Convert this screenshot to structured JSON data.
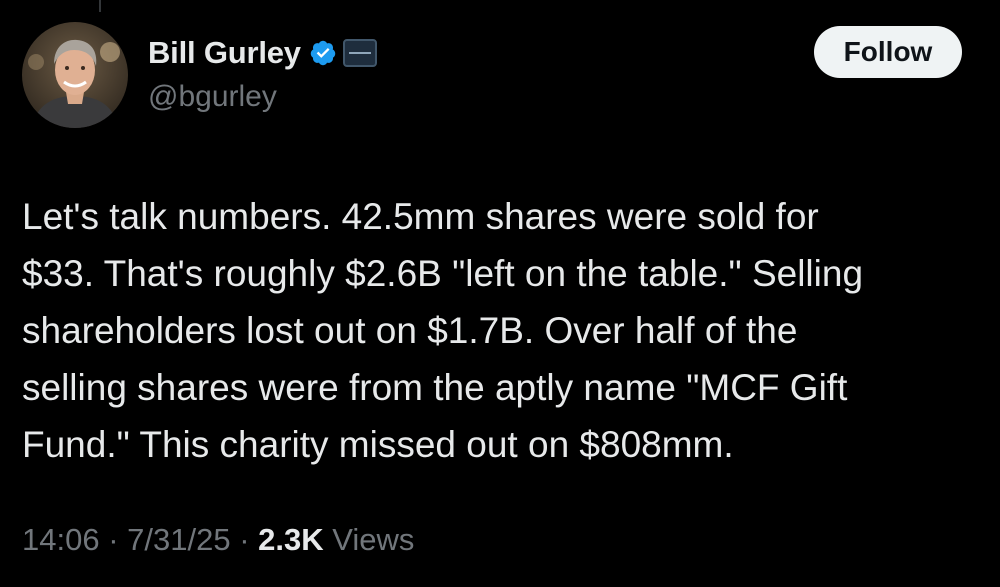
{
  "author": {
    "display_name": "Bill Gurley",
    "handle": "@bgurley",
    "verified_icon": "verified-badge-icon",
    "affiliate_badge_icon": "benchmark-logo-icon",
    "accent_color": "#1d9bf0"
  },
  "follow_button": {
    "label": "Follow"
  },
  "tweet": {
    "lines": [
      "Let's talk numbers. 42.5mm shares were sold for",
      "$33. That's roughly $2.6B \"left on the table.\" Selling",
      "shareholders lost out on $1.7B. Over half of the",
      "selling shares were from the aptly name \"MCF Gift",
      "Fund.\" This charity missed out on $808mm."
    ]
  },
  "meta": {
    "time": "14:06",
    "separator": " · ",
    "date": "7/31/25",
    "views_count": "2.3K",
    "views_label": " Views"
  },
  "colors": {
    "background": "#000000",
    "text": "#e7e9ea",
    "secondary_text": "#71767b",
    "button_bg": "#eff3f4"
  }
}
